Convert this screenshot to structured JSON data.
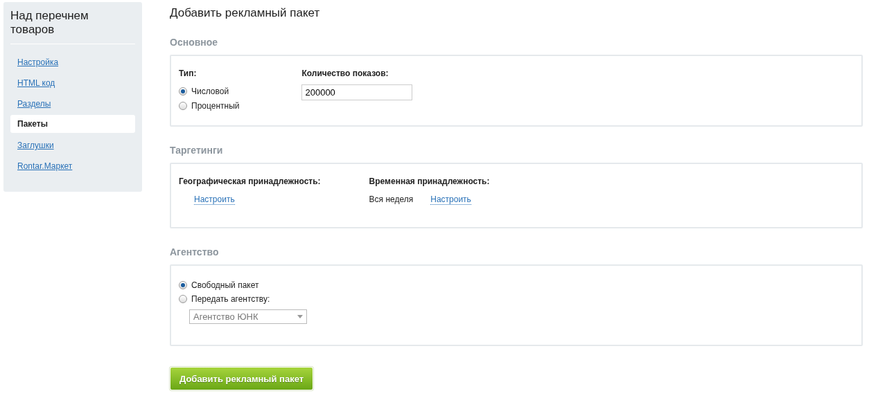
{
  "sidebar": {
    "title": "Над перечнем товаров",
    "items": [
      {
        "label": "Настройка",
        "selected": false
      },
      {
        "label": "HTML код",
        "selected": false
      },
      {
        "label": "Разделы",
        "selected": false
      },
      {
        "label": "Пакеты",
        "selected": true
      },
      {
        "label": "Заглушки",
        "selected": false
      },
      {
        "label": "Rontar.Маркет",
        "selected": false
      }
    ]
  },
  "page_title": "Добавить рекламный пакет",
  "basic": {
    "heading": "Основное",
    "type_label": "Тип:",
    "type_options": [
      {
        "label": "Числовой",
        "selected": true
      },
      {
        "label": "Процентный",
        "selected": false
      }
    ],
    "impressions_label": "Количество показов:",
    "impressions_value": "200000"
  },
  "targeting": {
    "heading": "Таргетинги",
    "geo_label": "Географическая принадлежность:",
    "geo_link": "Настроить",
    "time_label": "Временная принадлежность:",
    "time_value": "Вся неделя",
    "time_link": "Настроить"
  },
  "agency": {
    "heading": "Агентство",
    "options": [
      {
        "label": "Свободный пакет",
        "selected": true
      },
      {
        "label": "Передать агентству:",
        "selected": false
      }
    ],
    "dropdown": {
      "value": "Агентство ЮНК",
      "disabled": true
    }
  },
  "submit_button": "Добавить рекламный пакет"
}
